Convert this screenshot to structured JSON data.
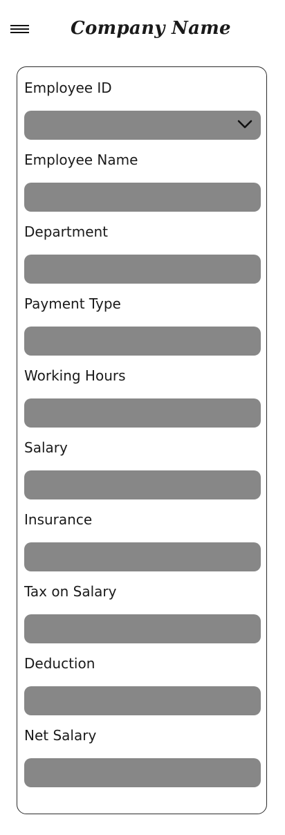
{
  "header": {
    "title": "Company Name",
    "menu_icon": "hamburger-menu-icon"
  },
  "form": {
    "fields": [
      {
        "key": "employee_id",
        "label": "Employee ID",
        "type": "dropdown",
        "value": ""
      },
      {
        "key": "employee_name",
        "label": "Employee Name",
        "type": "text",
        "value": ""
      },
      {
        "key": "department",
        "label": "Department",
        "type": "text",
        "value": ""
      },
      {
        "key": "payment_type",
        "label": "Payment Type",
        "type": "text",
        "value": ""
      },
      {
        "key": "working_hours",
        "label": "Working Hours",
        "type": "text",
        "value": ""
      },
      {
        "key": "salary",
        "label": "Salary",
        "type": "text",
        "value": ""
      },
      {
        "key": "insurance",
        "label": "Insurance",
        "type": "text",
        "value": ""
      },
      {
        "key": "tax_on_salary",
        "label": "Tax on Salary",
        "type": "text",
        "value": ""
      },
      {
        "key": "deduction",
        "label": "Deduction",
        "type": "text",
        "value": ""
      },
      {
        "key": "net_salary",
        "label": "Net Salary",
        "type": "text",
        "value": ""
      }
    ]
  },
  "colors": {
    "input_fill": "#878787",
    "card_border": "#2a2a2a",
    "text": "#1a1a1a"
  }
}
